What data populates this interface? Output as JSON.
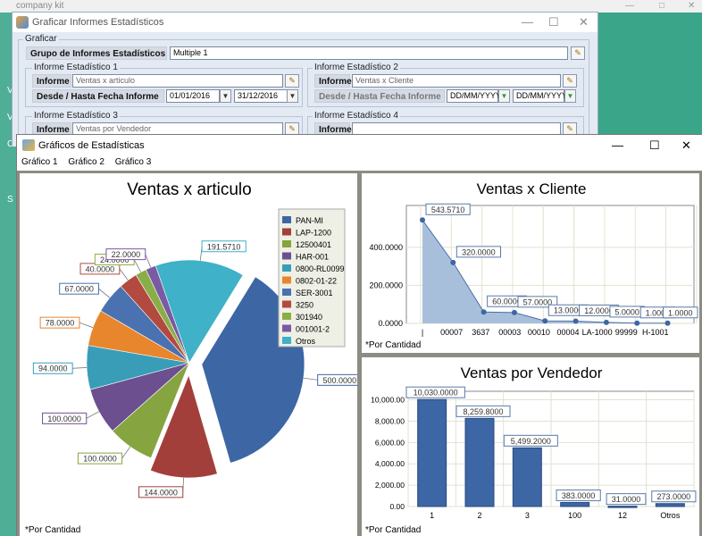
{
  "background_app": {
    "title": "company kit",
    "sidebar_letters": [
      "V",
      "V",
      "C",
      "S"
    ]
  },
  "graficar_window": {
    "title": "Graficar Informes Estadísticos",
    "group_title": "Graficar",
    "grupo_label": "Grupo de Informes Estadísticos",
    "grupo_value": "Multiple 1",
    "informes": [
      {
        "title": "Informe Estadístico 1",
        "informe_label": "Informe",
        "informe_value": "Ventas x articulo",
        "fecha_label": "Desde / Hasta Fecha Informe",
        "desde": "01/01/2016",
        "hasta": "31/12/2016"
      },
      {
        "title": "Informe Estadístico 2",
        "informe_label": "Informe",
        "informe_value": "Ventas x Cliente",
        "fecha_label": "Desde / Hasta Fecha Informe",
        "desde": "DD/MM/YYYY",
        "hasta": "DD/MM/YYYY"
      },
      {
        "title": "Informe Estadístico 3",
        "informe_label": "Informe",
        "informe_value": "Ventas por Vendedor"
      },
      {
        "title": "Informe Estadístico 4",
        "informe_label": "Informe",
        "informe_value": ""
      }
    ]
  },
  "charts_window": {
    "title": "Gráficos de Estadísticas",
    "menu": [
      "Gráfico 1",
      "Gráfico 2",
      "Gráfico 3"
    ]
  },
  "colors": {
    "pie": [
      "#3d66a4",
      "#a33f3b",
      "#86a43f",
      "#6b4f8f",
      "#3a9db8",
      "#e8862e",
      "#4a72b0",
      "#b24a3f",
      "#8aae47",
      "#7a5aa2",
      "#3fb1c8"
    ],
    "area_fill": "#a8bfdc",
    "area_line": "#4a6ea8",
    "bar": "#3d66a4"
  },
  "chart_data": [
    {
      "type": "pie",
      "title": "Ventas x articulo",
      "footnote": "*Por Cantidad",
      "legend_position": "top-right",
      "labels": [
        "PAN-MI",
        "LAP-1200",
        "12500401",
        "HAR-001",
        "0800-RL0099",
        "0802-01-22",
        "SER-3001",
        "3250",
        "301940",
        "001001-2",
        "Otros"
      ],
      "values": [
        500,
        144,
        100,
        100,
        94,
        78,
        67,
        40,
        24,
        22,
        191.571
      ],
      "value_labels": [
        "500.0000",
        "144.0000",
        "100.0000",
        "100.0000",
        "94.0000",
        "78.0000",
        "67.0000",
        "40.0000",
        "24.0000",
        "22.0000",
        "191.5710"
      ],
      "exploded": [
        0,
        1
      ]
    },
    {
      "type": "area",
      "title": "Ventas x Cliente",
      "footnote": "*Por Cantidad",
      "categories": [
        "|",
        "00007",
        "3637",
        "00003",
        "00010",
        "00004",
        "LA-1000",
        "99999",
        "H-1001",
        ""
      ],
      "values": [
        543.571,
        320,
        60,
        57,
        13,
        12,
        5,
        1,
        1
      ],
      "value_labels": [
        "543.5710",
        "320.0000",
        "60.0000",
        "57.0000",
        "13.0000",
        "12.0000",
        "5.0000",
        "1.0000",
        "1.0000"
      ],
      "yticks": [
        "0.0000",
        "200.0000",
        "400.0000"
      ],
      "ylim": [
        0,
        620
      ]
    },
    {
      "type": "bar",
      "title": "Ventas por Vendedor",
      "footnote": "*Por Cantidad",
      "categories": [
        "1",
        "2",
        "3",
        "100",
        "12",
        "Otros"
      ],
      "values": [
        10030,
        8259.8,
        5499.2,
        383,
        31,
        273
      ],
      "value_labels": [
        "10,030.0000",
        "8,259.8000",
        "5,499.2000",
        "383.0000",
        "31.0000",
        "273.0000"
      ],
      "yticks": [
        "0.00",
        "2,000.00",
        "4,000.00",
        "6,000.00",
        "8,000.00",
        "10,000.00"
      ],
      "ylim": [
        0,
        10800
      ]
    }
  ]
}
